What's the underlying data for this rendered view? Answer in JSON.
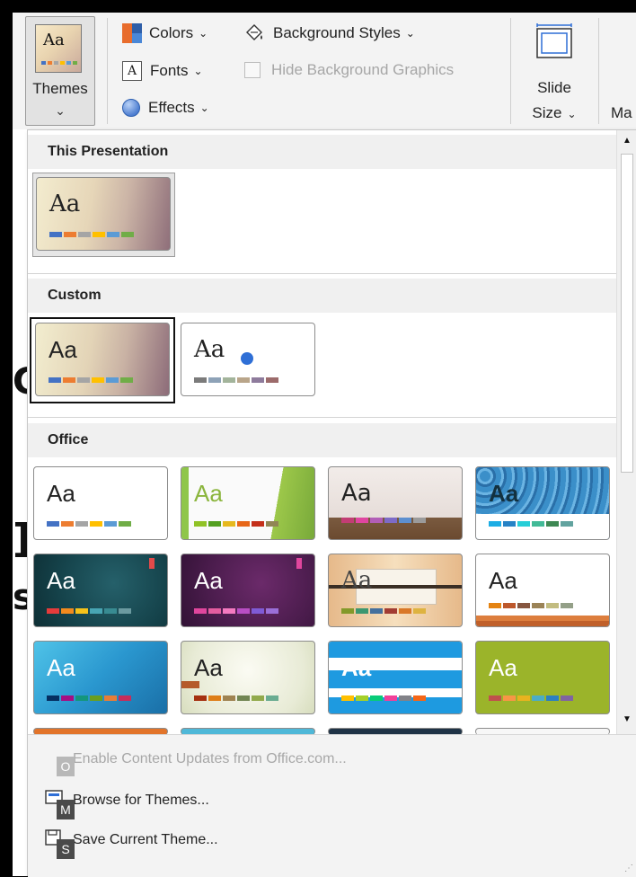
{
  "ribbon": {
    "themes_label": "Themes",
    "themes_chevron": "⌄",
    "themes_thumb_text": "Aa",
    "colors_label": "Colors",
    "fonts_label": "Fonts",
    "fonts_icon_text": "A",
    "effects_label": "Effects",
    "background_styles_label": "Background Styles",
    "hide_bg_graphics_label": "Hide Background Graphics",
    "slide_size_line1": "Slide",
    "slide_size_line2": "Size",
    "partial_label": "Ma",
    "chevron": "⌄"
  },
  "gallery": {
    "sections": {
      "this_presentation": "This Presentation",
      "custom": "Custom",
      "office": "Office"
    },
    "thumb_text": "Aa"
  },
  "footer": {
    "enable_updates_label": "Enable Content Updates from Office.com...",
    "enable_updates_keytip": "O",
    "browse_label": "Browse for Themes...",
    "browse_keytip": "M",
    "save_label": "Save Current Theme...",
    "save_keytip": "S"
  },
  "colors": {
    "accent": "#4472c4",
    "selection_border": "#111111"
  }
}
